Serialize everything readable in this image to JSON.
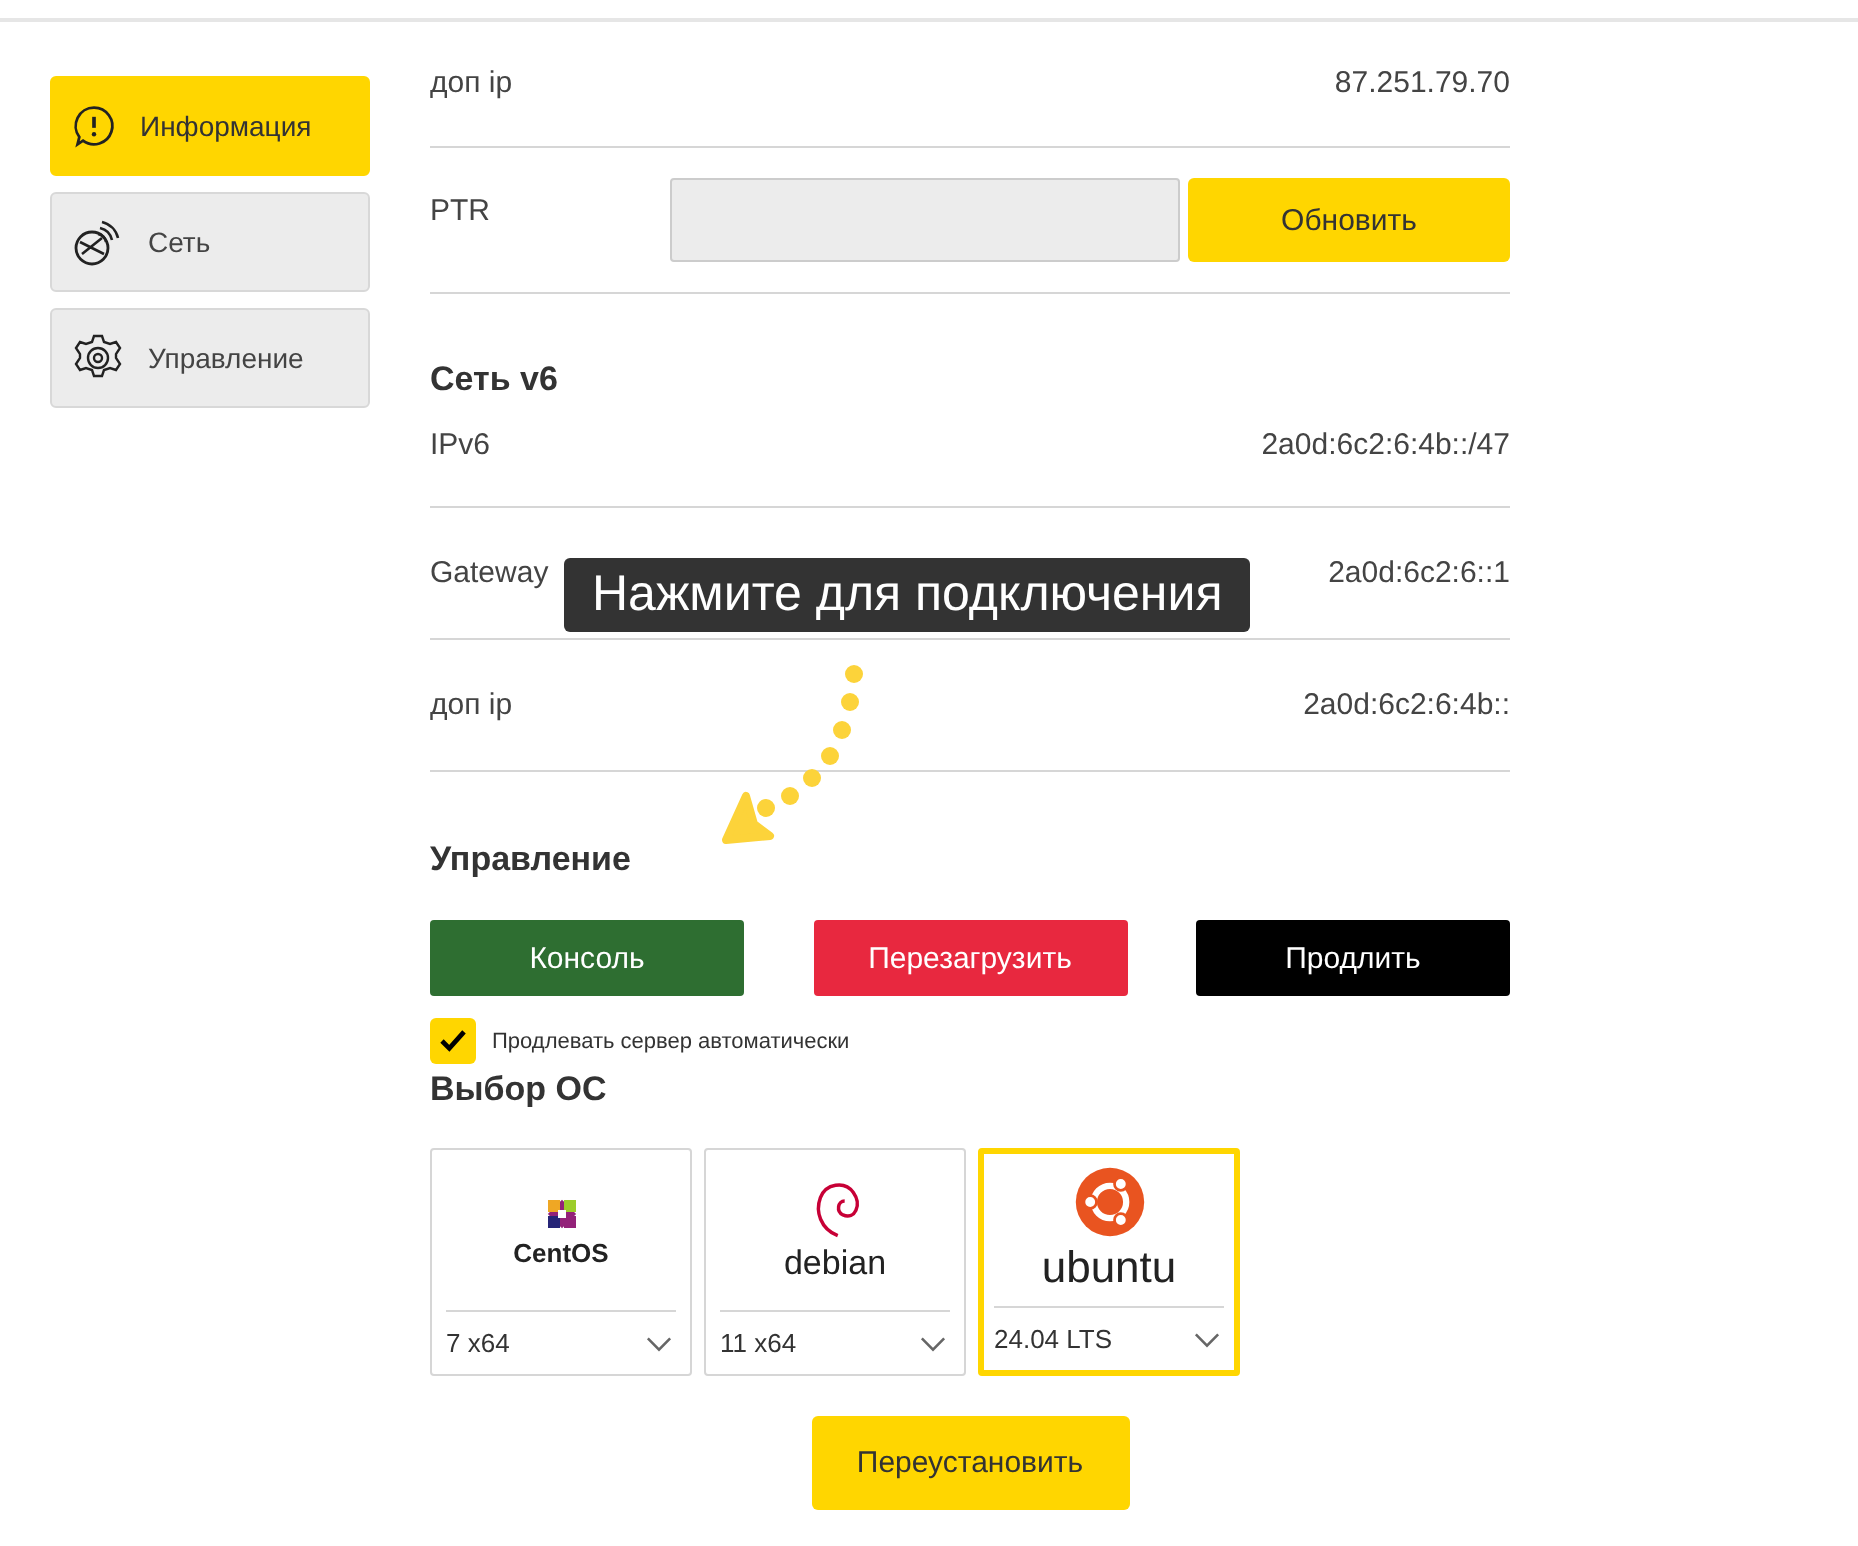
{
  "sidebar": {
    "items": [
      {
        "label": "Информация",
        "selected": true
      },
      {
        "label": "Сеть",
        "selected": false
      },
      {
        "label": "Управление",
        "selected": false
      }
    ]
  },
  "network": {
    "rows": [
      {
        "label": "доп ip",
        "value": "87.251.79.70"
      }
    ],
    "ptr": {
      "label": "PTR",
      "button": "Обновить"
    }
  },
  "network_v6": {
    "title": "Сеть v6",
    "rows": [
      {
        "label": "IPv6",
        "value": "2a0d:6c2:6:4b::/47"
      },
      {
        "label": "Gateway",
        "value": "2a0d:6c2:6::1"
      },
      {
        "label": "доп ip",
        "value": "2a0d:6c2:6:4b::"
      }
    ]
  },
  "tooltip": "Нажмите для подключения",
  "management": {
    "title": "Управление",
    "buttons": [
      {
        "label": "Консоль",
        "color": "#2e6e31"
      },
      {
        "label": "Перезагрузить",
        "color": "#e8283f"
      },
      {
        "label": "Продлить",
        "color": "#000000"
      }
    ],
    "auto_renew": {
      "label": "Продлевать сервер автоматически",
      "checked": true
    }
  },
  "os_choice": {
    "title": "Выбор ОС",
    "options": [
      {
        "kind": "centos",
        "name": "CentOS",
        "version": "7 x64",
        "selected": false
      },
      {
        "kind": "debian",
        "name": "debian",
        "version": "11 x64",
        "selected": false
      },
      {
        "kind": "ubuntu",
        "name": "ubuntu",
        "version": "24.04 LTS",
        "selected": true
      }
    ],
    "reinstall_button": "Переустановить"
  }
}
